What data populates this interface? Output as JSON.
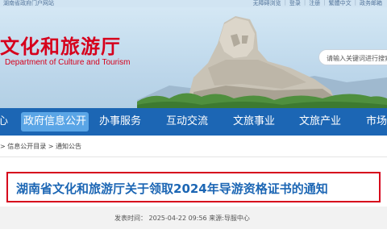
{
  "topbar": {
    "left_link": "湖南省政府门户网站",
    "links": [
      "无障碍浏览",
      "登录",
      "注册",
      "繁體中文",
      "政务邮箱"
    ]
  },
  "header": {
    "title": "文化和旅游厅",
    "subtitle": "Department of Culture and Tourism",
    "search_placeholder": "请输入关键词进行搜索"
  },
  "nav": {
    "items": [
      "心",
      "政府信息公开",
      "办事服务",
      "互动交流",
      "文旅事业",
      "文旅产业",
      "市场"
    ]
  },
  "breadcrumb": {
    "text": "> 信息公开目录 > 通知公告"
  },
  "article": {
    "title": "湖南省文化和旅游厅关于领取2024年导游资格证书的通知",
    "meta": "发表时间： 2025-04-22 09:56    来源:导服中心"
  },
  "colors": {
    "brand_red": "#d6001c",
    "nav_blue": "#1c66b4",
    "nav_active": "#5aa5e6"
  }
}
